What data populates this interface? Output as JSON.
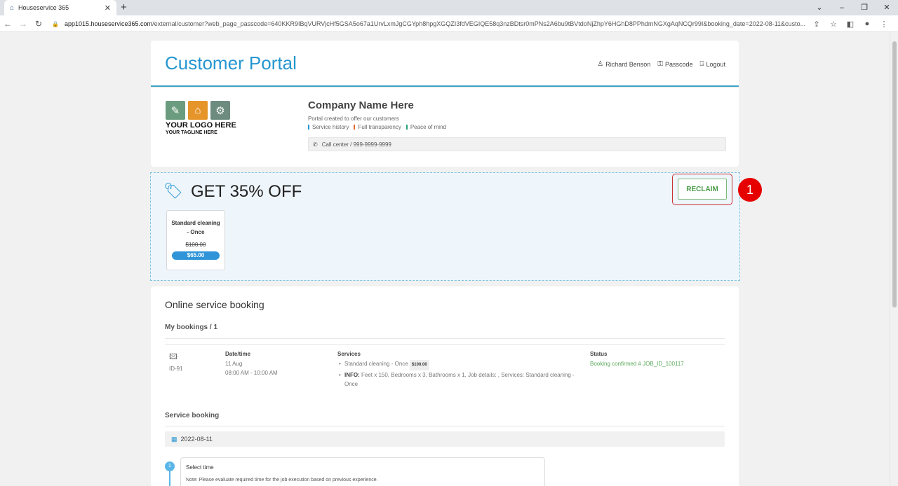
{
  "browser": {
    "tab_title": "Houseservice 365",
    "url_host": "app1015.houseservice365.com",
    "url_path": "/external/customer?web_page_passcode=640KKR9IBqVURVjcHf5GSA5o67a1UrvLxmJgCGYph8hpgXGQZI3fdVEGIQE58q3nzBDtsr0mPNs2A6bu9tBVtdoNjZhpY6HGhD8PPhdmNGXgAqNCQr99I&booking_date=2022-08-11&custo..."
  },
  "header": {
    "title": "Customer Portal",
    "user_name": "Richard Benson",
    "passcode_label": "Passcode",
    "logout_label": "Logout"
  },
  "company": {
    "logo_text": "YOUR LOGO HERE",
    "logo_tagline": "YOUR TAGLINE HERE",
    "name": "Company Name Here",
    "description": "Portal created to offer our customers",
    "features": [
      "Service history",
      "Full transparency",
      "Peace of mind"
    ],
    "call_center": "Call center / 999-9999-9999"
  },
  "promo": {
    "title": "GET 35% OFF",
    "button_label": "RECLAIM",
    "marker_number": "1",
    "offer": {
      "name": "Standard cleaning - Once",
      "old_price": "$100.00",
      "new_price": "$65.00"
    }
  },
  "booking": {
    "title": "Online service booking",
    "my_bookings": "My bookings / 1",
    "item": {
      "id": "ID-91",
      "datetime_header": "Date/time",
      "date": "11 Aug",
      "time": "08:00 AM - 10:00 AM",
      "services_header": "Services",
      "service_line": "Standard cleaning - Once",
      "service_price": "$100.00",
      "info_label": "INFO:",
      "info_text": "Feet x 150, Bedrooms x 3, Bathrooms x 1, Job details: , Services: Standard cleaning - Once",
      "status_header": "Status",
      "status": "Booking confirmed # JOB_ID_100117"
    },
    "service_booking_title": "Service booking",
    "date_value": "2022-08-11",
    "step_number": "1",
    "step_title": "Select time",
    "step_note": "Note: Please evaluate required time for the job execution based on previous experience."
  },
  "colors": {
    "accent": "#2596d0",
    "reclaim_green": "#4b9a49",
    "marker_red": "#e60000"
  }
}
